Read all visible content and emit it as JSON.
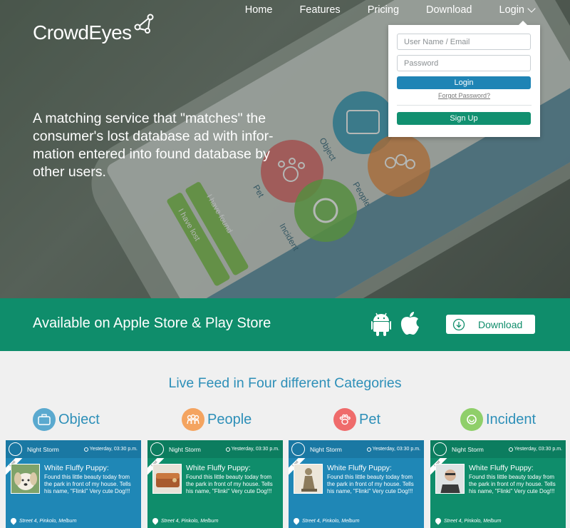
{
  "brand": {
    "name": "CrowdEyes"
  },
  "nav": {
    "items": [
      "Home",
      "Features",
      "Pricing",
      "Download"
    ],
    "login": "Login"
  },
  "hero": {
    "tagline": "A matching service that \"matches\" the consumer's lost database ad with infor-mation entered into found database by other users.",
    "phone_labels": {
      "object": "Object",
      "pet": "Pet",
      "people": "People",
      "incident": "Incident",
      "lost": "I have lost",
      "found": "I have found"
    }
  },
  "login_form": {
    "user_placeholder": "User Name / Email",
    "pass_placeholder": "Password",
    "login_btn": "Login",
    "forgot": "Forgot Password?",
    "signup_btn": "Sign Up"
  },
  "banner": {
    "text": "Available on Apple Store & Play Store",
    "download": "Download"
  },
  "feed": {
    "title": "Live Feed in Four different Categories",
    "categories": [
      {
        "label": "Object",
        "color": "#2d8fb8",
        "circle": "#5aa9cf",
        "icon": "briefcase-icon"
      },
      {
        "label": "People",
        "color": "#2d8fb8",
        "circle": "#f4a460",
        "icon": "people-icon"
      },
      {
        "label": "Pet",
        "color": "#2d8fb8",
        "circle": "#ef6b6b",
        "icon": "paw-icon"
      },
      {
        "label": "Incident",
        "color": "#2d8fb8",
        "circle": "#8fcf6a",
        "icon": "incident-icon"
      }
    ],
    "cards": [
      {
        "user": "Night Storm",
        "time": "Yesterday,  03:30 p.m.",
        "ribbon": "Lost",
        "title": "White Fluffy Puppy:",
        "text": "Found this little beauty today from the park in front of my house. Tells his name, \"Flinki\" Very cute Dog!!!",
        "location": "Street 4, Pinkolo, Melburn",
        "color": "#1f87b6"
      },
      {
        "user": "Night Storm",
        "time": "Yesterday,  03:30 p.m.",
        "ribbon": "Lost",
        "title": "White Fluffy Puppy:",
        "text": "Found this little beauty today from the park in front of my house. Tells his name, \"Flinki\" Very cute Dog!!!",
        "location": "Street 4, Pinkolo, Melburn",
        "color": "#0f8d6b"
      },
      {
        "user": "Night Storm",
        "time": "Yesterday,  03:30 p.m.",
        "ribbon": "Lost",
        "title": "White Fluffy Puppy:",
        "text": "Found this little beauty today from the park in front of my house. Tells his name, \"Flinki\" Very cute Dog!!!",
        "location": "Street 4, Pinkolo, Melburn",
        "color": "#1f87b6"
      },
      {
        "user": "Night Storm",
        "time": "Yesterday,  03:30 p.m.",
        "ribbon": "Lost",
        "title": "White Fluffy Puppy:",
        "text": "Found this little beauty today from the park in front of my house. Tells his name, \"Flinki\" Very cute Dog!!!",
        "location": "Street 4, Pinkolo, Melburn",
        "color": "#0f8d6b"
      }
    ]
  }
}
